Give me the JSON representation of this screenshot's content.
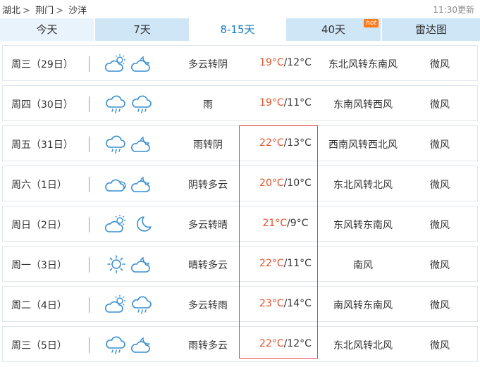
{
  "breadcrumb": {
    "province": "湖北",
    "sep": ">",
    "city": "荆门",
    "district": "沙洋"
  },
  "update_time": "11:30更新",
  "tabs": [
    {
      "label": "今天"
    },
    {
      "label": "7天"
    },
    {
      "label": "8-15天"
    },
    {
      "label": "40天",
      "badge": "hot"
    },
    {
      "label": "雷达图"
    }
  ],
  "active_tab": "8-15天",
  "colors": {
    "high_temp": "#e2522b",
    "highlight_border": "#e0474c",
    "active_tab_text": "#1a7cc2",
    "tab_bg": "#cfe6f7",
    "hot_badge": "#ff7a1a"
  },
  "forecast": [
    {
      "day": "周三（29日）",
      "icon1": "partly-cloudy-day-icon",
      "icon2": "partly-cloudy-night-icon",
      "desc": "多云转阴",
      "high": "19°C",
      "low": "/12°C",
      "wind_dir": "东北风转东南风",
      "wind_level": "微风"
    },
    {
      "day": "周四（30日）",
      "icon1": "rain-icon",
      "icon2": "rain-icon",
      "desc": "雨",
      "high": "19°C",
      "low": "/11°C",
      "wind_dir": "东南风转西风",
      "wind_level": "微风"
    },
    {
      "day": "周五（31日）",
      "icon1": "rain-icon",
      "icon2": "partly-cloudy-night-icon",
      "desc": "雨转阴",
      "high": "22°C",
      "low": "/13°C",
      "wind_dir": "西南风转西北风",
      "wind_level": "微风"
    },
    {
      "day": "周六（1日）",
      "icon1": "overcast-icon",
      "icon2": "partly-cloudy-night-icon",
      "desc": "阴转多云",
      "high": "20°C",
      "low": "/10°C",
      "wind_dir": "东北风转北风",
      "wind_level": "微风"
    },
    {
      "day": "周日（2日）",
      "icon1": "partly-cloudy-day-icon",
      "icon2": "moon-icon",
      "desc": "多云转晴",
      "high": "21°C",
      "low": "/9°C",
      "wind_dir": "东风转东南风",
      "wind_level": "微风"
    },
    {
      "day": "周一（3日）",
      "icon1": "sun-icon",
      "icon2": "partly-cloudy-night-icon",
      "desc": "晴转多云",
      "high": "22°C",
      "low": "/11°C",
      "wind_dir": "南风",
      "wind_level": "微风"
    },
    {
      "day": "周二（4日）",
      "icon1": "partly-cloudy-day-icon",
      "icon2": "rain-icon",
      "desc": "多云转雨",
      "high": "23°C",
      "low": "/14°C",
      "wind_dir": "南风转东南风",
      "wind_level": "微风"
    },
    {
      "day": "周三（5日）",
      "icon1": "rain-icon",
      "icon2": "partly-cloudy-night-icon",
      "desc": "雨转多云",
      "high": "22°C",
      "low": "/12°C",
      "wind_dir": "东北风转北风",
      "wind_level": "微风"
    }
  ]
}
